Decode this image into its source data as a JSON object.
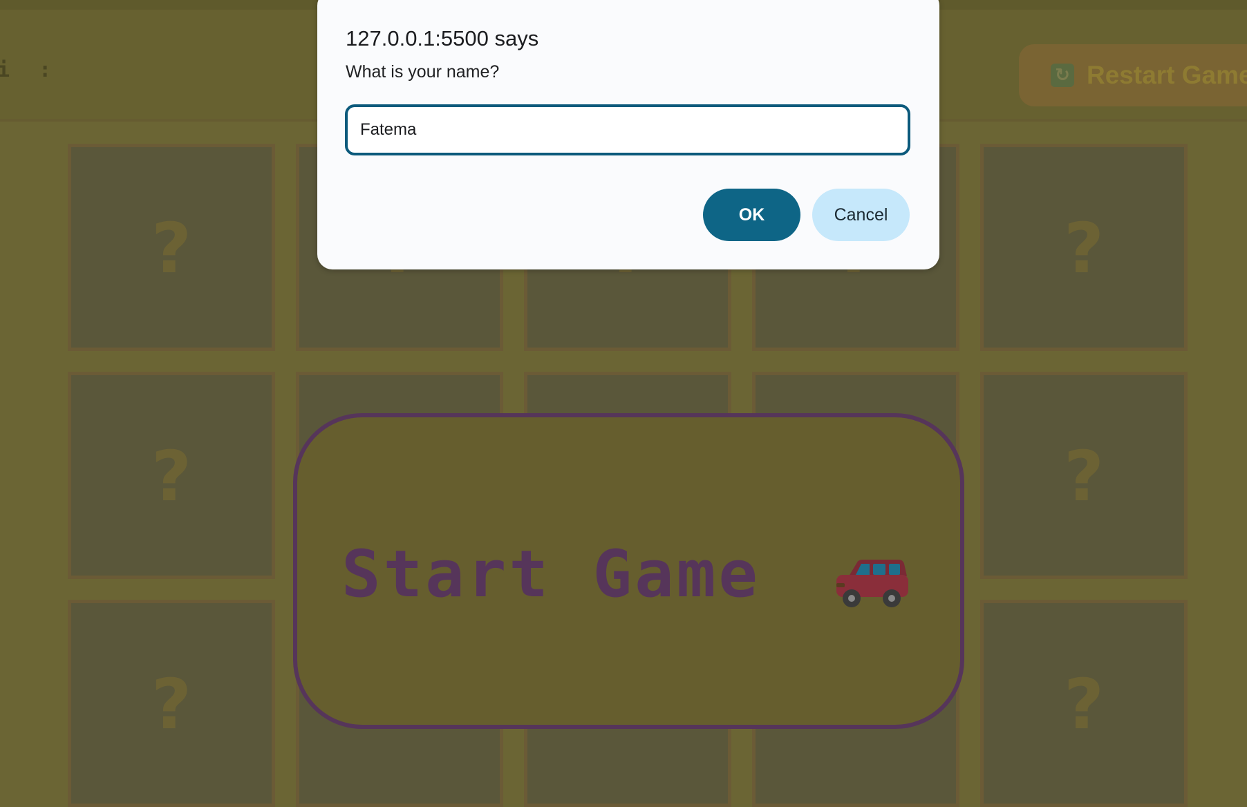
{
  "page": {
    "topbar_text": "i :",
    "restart_button": {
      "icon": "refresh-icon",
      "label": "Restart Game"
    },
    "cards": [
      {
        "label": "?"
      },
      {
        "label": "?"
      },
      {
        "label": "?"
      },
      {
        "label": "?"
      },
      {
        "label": "?"
      },
      {
        "label": "?"
      },
      {
        "label": "?"
      },
      {
        "label": "?"
      },
      {
        "label": "?"
      },
      {
        "label": "?"
      },
      {
        "label": "?"
      },
      {
        "label": "?"
      },
      {
        "label": "?"
      },
      {
        "label": "?"
      },
      {
        "label": "?"
      }
    ],
    "start_button": {
      "label": "Start Game",
      "icon": "car-icon"
    }
  },
  "dialog": {
    "title": "127.0.0.1:5500 says",
    "message": "What is your name?",
    "input_value": "Fatema",
    "ok_label": "OK",
    "cancel_label": "Cancel"
  },
  "colors": {
    "accent": "#0e6586",
    "cancel_bg": "#c6e8fb",
    "start_text": "#56355a",
    "overlay_bg": "#6b6534"
  }
}
